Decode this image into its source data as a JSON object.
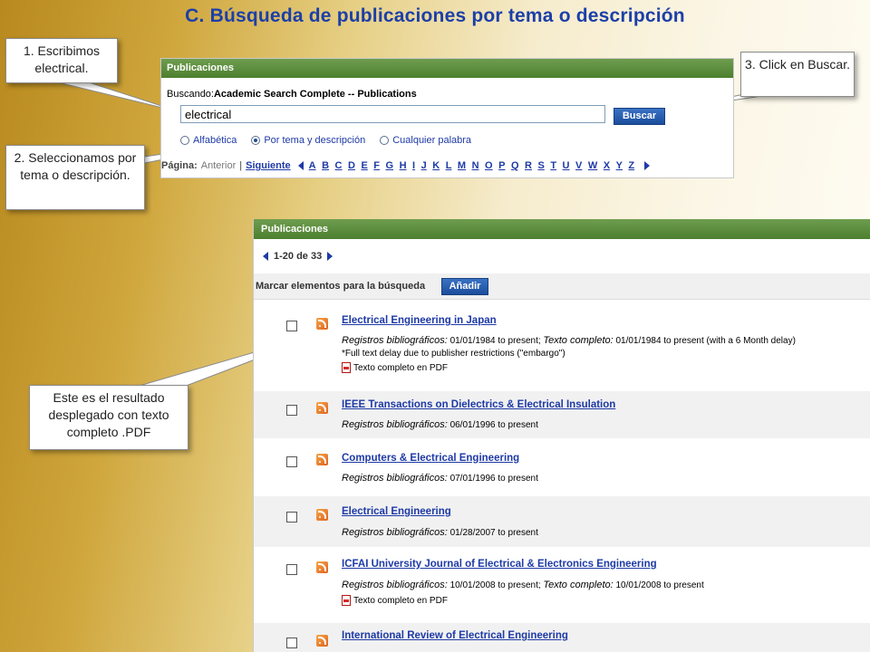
{
  "slide_title": "C. Búsqueda de publicaciones por tema o descripción",
  "search_panel": {
    "header": "Publicaciones",
    "searching_label": "Buscando:",
    "searching_db": "Academic Search Complete -- Publications",
    "input_value": "electrical",
    "search_button": "Buscar",
    "radio_options": [
      {
        "label": "Alfabética",
        "checked": false
      },
      {
        "label": "Por tema y descripción",
        "checked": true
      },
      {
        "label": "Cualquier palabra",
        "checked": false
      }
    ],
    "page_label": "Página:",
    "previous": "Anterior",
    "separator": "|",
    "next": "Siguiente",
    "letters": [
      "A",
      "B",
      "C",
      "D",
      "E",
      "F",
      "G",
      "H",
      "I",
      "J",
      "K",
      "L",
      "M",
      "N",
      "O",
      "P",
      "Q",
      "R",
      "S",
      "T",
      "U",
      "V",
      "W",
      "X",
      "Y",
      "Z"
    ]
  },
  "results_panel": {
    "header": "Publicaciones",
    "range": "1-20 de 33",
    "mark_label": "Marcar elementos para la búsqueda",
    "add_button": "Añadir",
    "results": [
      {
        "title": "Electrical Engineering in Japan",
        "line1_label": "Registros bibliográficos:",
        "line1_value": "01/01/1984 to present;",
        "line1_label2": "Texto completo:",
        "line1_value2": "01/01/1984 to present (with a 6 Month delay)",
        "line2": "*Full text delay due to publisher restrictions (\"embargo\")",
        "pdf": "Texto completo en PDF"
      },
      {
        "title": "IEEE Transactions on Dielectrics & Electrical Insulation",
        "line1_label": "Registros bibliográficos:",
        "line1_value": "06/01/1996 to present"
      },
      {
        "title": "Computers & Electrical Engineering",
        "line1_label": "Registros bibliográficos:",
        "line1_value": "07/01/1996 to present"
      },
      {
        "title": "Electrical Engineering",
        "line1_label": "Registros bibliográficos:",
        "line1_value": "01/28/2007 to present"
      },
      {
        "title": "ICFAI University Journal of Electrical & Electronics Engineering",
        "line1_label": "Registros bibliográficos:",
        "line1_value": "10/01/2008 to present;",
        "line1_label2": "Texto completo:",
        "line1_value2": "10/01/2008 to present",
        "pdf": "Texto completo en PDF"
      },
      {
        "title": "International Review of Electrical Engineering"
      }
    ]
  },
  "callouts": {
    "step1": "1. Escribimos electrical.",
    "step2": "2. Seleccionamos por tema o descripción.",
    "step3": "3. Click en Buscar.",
    "result_note": "Este es el resultado desplegado con texto completo .PDF"
  },
  "colors": {
    "title_blue": "#1c3fa8",
    "header_green": "#5a8a3a",
    "link_blue": "#1e3aa6",
    "button_blue": "#2a5fb0"
  }
}
